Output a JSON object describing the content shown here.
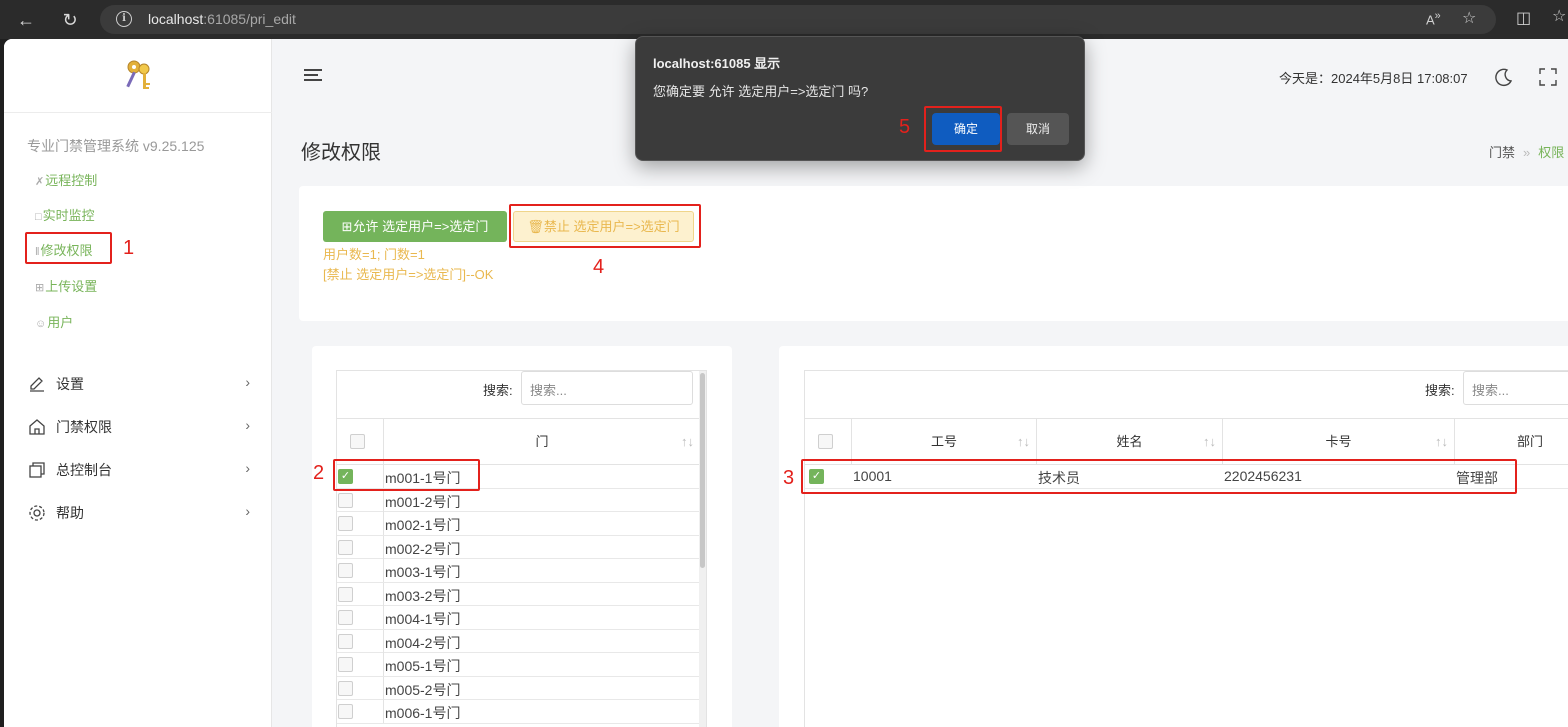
{
  "browser": {
    "url_host": "localhost",
    "url_rest": ":61085/pri_edit"
  },
  "sidebar": {
    "system_name": "专业门禁管理系统 v9.25.125",
    "sub_items": [
      {
        "label": "远程控制",
        "icon": "tools-icon"
      },
      {
        "label": "实时监控",
        "icon": "monitor-icon"
      },
      {
        "label": "修改权限",
        "icon": "sliders-icon"
      },
      {
        "label": "上传设置",
        "icon": "upload-icon"
      },
      {
        "label": "用户",
        "icon": "users-icon"
      }
    ],
    "main_items": [
      {
        "label": "设置",
        "icon": "edit-icon"
      },
      {
        "label": "门禁权限",
        "icon": "home-icon"
      },
      {
        "label": "总控制台",
        "icon": "console-icon"
      },
      {
        "label": "帮助",
        "icon": "gear-icon"
      }
    ]
  },
  "header": {
    "today": "今天是：2024年5月8日 17:08:07"
  },
  "page": {
    "title": "修改权限",
    "breadcrumb": [
      "门禁",
      "权限"
    ]
  },
  "actions": {
    "allow_label": "允许 选定用户=>选定门",
    "deny_label": "禁止 选定用户=>选定门",
    "count_text": "用户数=1; 门数=1",
    "result_text": "[禁止 选定用户=>选定门]--OK"
  },
  "doors": {
    "search_label": "搜索:",
    "search_placeholder": "搜索...",
    "column": "门",
    "rows": [
      {
        "name": "m001-1号门",
        "checked": true
      },
      {
        "name": "m001-2号门",
        "checked": false
      },
      {
        "name": "m002-1号门",
        "checked": false
      },
      {
        "name": "m002-2号门",
        "checked": false
      },
      {
        "name": "m003-1号门",
        "checked": false
      },
      {
        "name": "m003-2号门",
        "checked": false
      },
      {
        "name": "m004-1号门",
        "checked": false
      },
      {
        "name": "m004-2号门",
        "checked": false
      },
      {
        "name": "m005-1号门",
        "checked": false
      },
      {
        "name": "m005-2号门",
        "checked": false
      },
      {
        "name": "m006-1号门",
        "checked": false
      }
    ]
  },
  "users": {
    "search_label": "搜索:",
    "search_placeholder": "搜索...",
    "columns": [
      "工号",
      "姓名",
      "卡号",
      "部门"
    ],
    "rows": [
      {
        "id": "10001",
        "name": "技术员",
        "card": "2202456231",
        "dept": "管理部",
        "checked": true
      }
    ]
  },
  "annotations": [
    "1",
    "2",
    "3",
    "4",
    "5"
  ],
  "dialog": {
    "title": "localhost:61085 显示",
    "message": "您确定要 允许 选定用户=>选定门 吗?",
    "ok_label": "确定",
    "cancel_label": "取消"
  },
  "colors": {
    "accent_green": "#74b45b",
    "warning_yellow": "#e9b84f",
    "annotation_red": "#e3211c",
    "dialog_primary": "#0f5cc0"
  }
}
